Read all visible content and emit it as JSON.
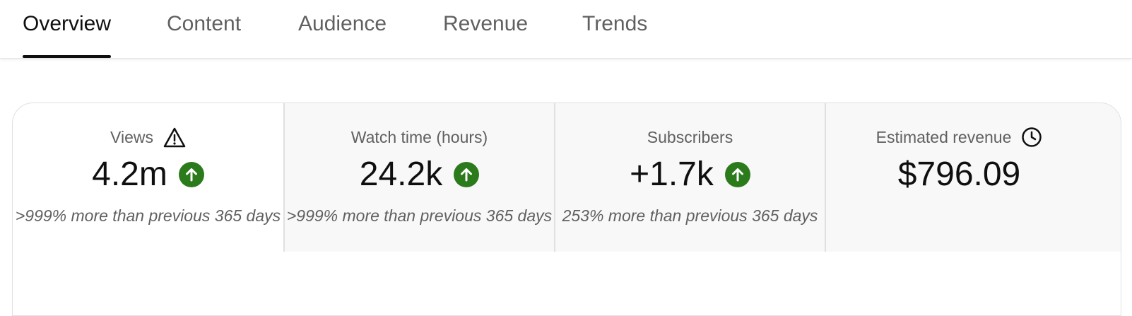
{
  "tabs": [
    {
      "label": "Overview",
      "active": true
    },
    {
      "label": "Content",
      "active": false
    },
    {
      "label": "Audience",
      "active": false
    },
    {
      "label": "Revenue",
      "active": false
    },
    {
      "label": "Trends",
      "active": false
    }
  ],
  "metrics": [
    {
      "title": "Views",
      "title_icon": "warning-icon",
      "value": "4.2m",
      "trend_icon": "arrow-up-icon",
      "comparison": ">999% more than previous 365 days"
    },
    {
      "title": "Watch time (hours)",
      "value": "24.2k",
      "trend_icon": "arrow-up-icon",
      "comparison": ">999% more than previous 365 days"
    },
    {
      "title": "Subscribers",
      "value": "+1.7k",
      "trend_icon": "arrow-up-icon",
      "comparison": "253% more than previous 365 days"
    },
    {
      "title": "Estimated revenue",
      "title_icon": "clock-icon",
      "value": "$796.09"
    }
  ],
  "colors": {
    "trend_up": "#2b7a1c",
    "active_tab": "#0f0f0f",
    "inactive_tab": "#606060",
    "shaded_card": "#f8f8f8"
  }
}
